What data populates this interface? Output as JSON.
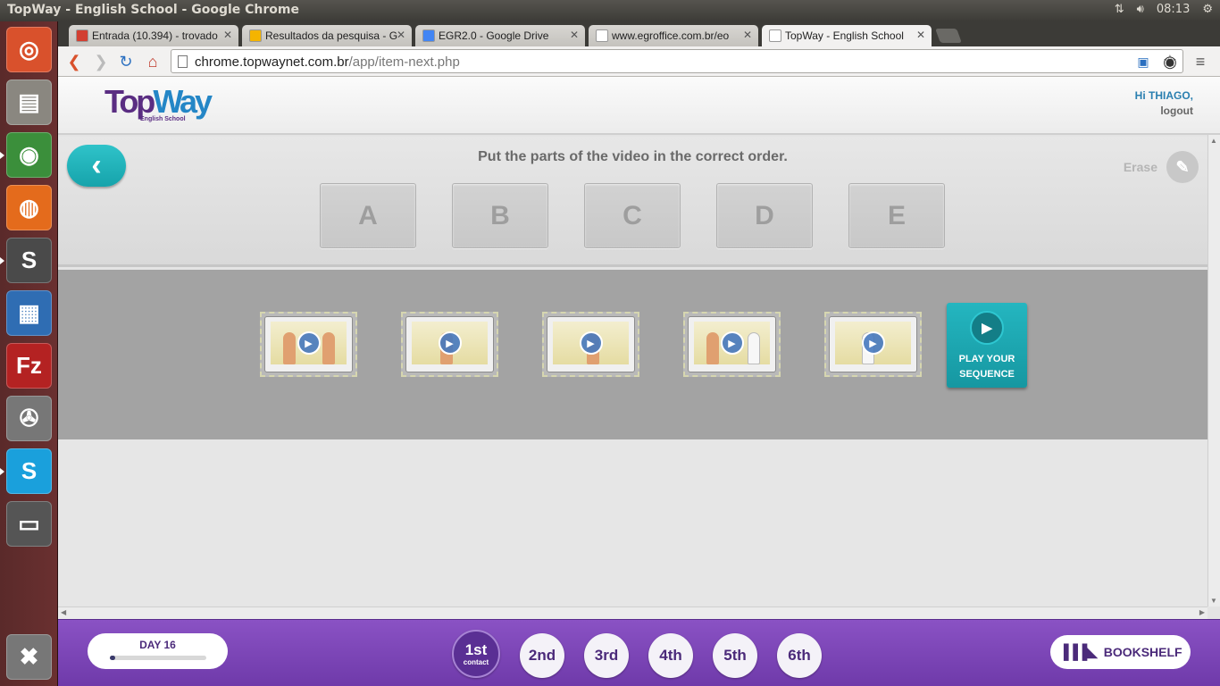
{
  "os": {
    "window_title": "TopWay - English School - Google Chrome",
    "clock": "08:13",
    "network_icon": "network-arrows-icon",
    "volume_icon": "speaker-icon",
    "settings_icon": "gear-icon"
  },
  "launcher": {
    "items": [
      {
        "name": "ubuntu-dash",
        "glyph": "◎",
        "color": "#d9512c"
      },
      {
        "name": "files",
        "glyph": "▤",
        "color": "#8a8780"
      },
      {
        "name": "chrome",
        "glyph": "◉",
        "color": "#3b8f3b"
      },
      {
        "name": "firefox",
        "glyph": "◍",
        "color": "#e46b1c"
      },
      {
        "name": "sublime-text",
        "glyph": "S",
        "color": "#4a4a4a"
      },
      {
        "name": "libreoffice-writer",
        "glyph": "▦",
        "color": "#2f6db3"
      },
      {
        "name": "filezilla",
        "glyph": "Fz",
        "color": "#b42222"
      },
      {
        "name": "system-settings",
        "glyph": "✇",
        "color": "#777"
      },
      {
        "name": "skype",
        "glyph": "S",
        "color": "#1aa0dc"
      },
      {
        "name": "save-disk",
        "glyph": "▭",
        "color": "#555"
      },
      {
        "name": "trash",
        "glyph": "✖",
        "color": "#777"
      }
    ]
  },
  "browser": {
    "tabs": [
      {
        "label": "Entrada (10.394) - trovado",
        "favicon": "gmail-icon",
        "fav_color": "#d23f31"
      },
      {
        "label": "Resultados da pesquisa - G",
        "favicon": "drive-icon",
        "fav_color": "#f4b400"
      },
      {
        "label": "EGR2.0 - Google Drive",
        "favicon": "docs-icon",
        "fav_color": "#4285f4"
      },
      {
        "label": "www.egroffice.com.br/eo",
        "favicon": "page-icon",
        "fav_color": "#ffffff"
      },
      {
        "label": "TopWay - English School",
        "favicon": "page-icon",
        "fav_color": "#ffffff"
      }
    ],
    "url_host": "chrome.topwaynet.com.br",
    "url_path": "/app/item-next.php"
  },
  "site": {
    "logo_top": "Top",
    "logo_way": "Way",
    "logo_sub": "English School",
    "greeting": "Hi THIAGO,",
    "logout": "logout"
  },
  "exercise": {
    "instruction": "Put the parts of the video in the correct order.",
    "erase_label": "Erase",
    "slots": [
      "A",
      "B",
      "C",
      "D",
      "E"
    ],
    "clips": [
      {
        "name": "clip-1",
        "scene": "two people at reception"
      },
      {
        "name": "clip-2",
        "scene": "confused man"
      },
      {
        "name": "clip-3",
        "scene": "man alone"
      },
      {
        "name": "clip-4",
        "scene": "man and nurse"
      },
      {
        "name": "clip-5",
        "scene": "nurse"
      }
    ],
    "play_sequence_label": "PLAY YOUR SEQUENCE"
  },
  "bottom_nav": {
    "day_label": "DAY 16",
    "day_progress": 0.06,
    "contacts": [
      {
        "label": "1st",
        "sub": "contact",
        "active": true
      },
      {
        "label": "2nd",
        "sub": "",
        "active": false
      },
      {
        "label": "3rd",
        "sub": "",
        "active": false
      },
      {
        "label": "4th",
        "sub": "",
        "active": false
      },
      {
        "label": "5th",
        "sub": "",
        "active": false
      },
      {
        "label": "6th",
        "sub": "",
        "active": false
      }
    ],
    "bookshelf_label": "BOOKSHELF"
  }
}
